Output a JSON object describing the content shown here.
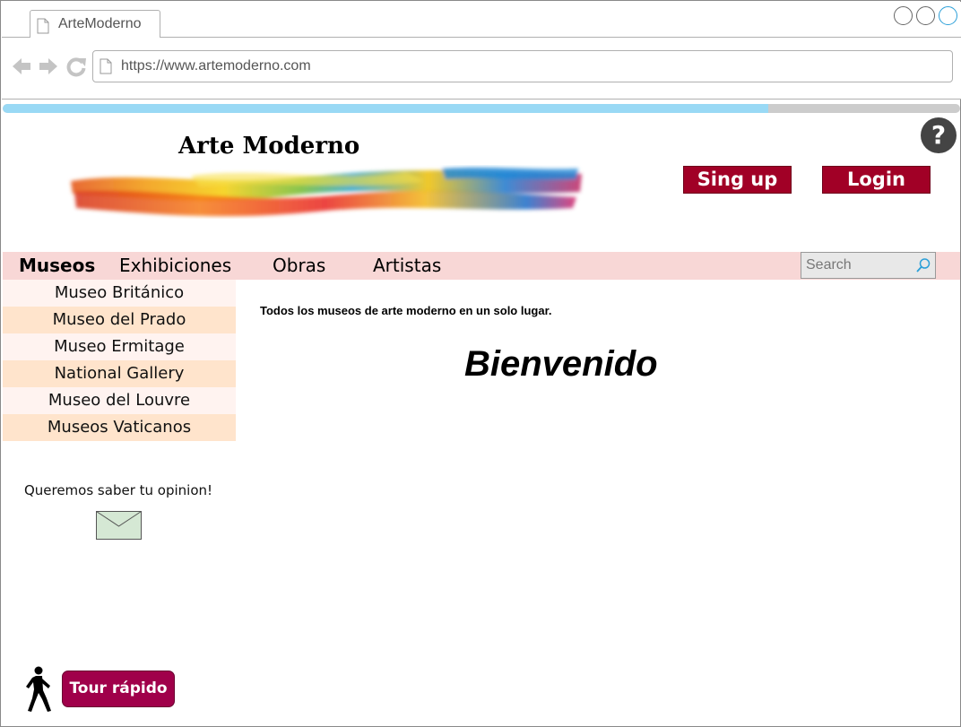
{
  "browser": {
    "tab_title": "ArteModerno",
    "url": "https://www.artemoderno.com",
    "loading_progress": 0.8
  },
  "header": {
    "site_title": "Arte Moderno",
    "signup_label": "Sing up",
    "login_label": "Login",
    "help_label": "?"
  },
  "nav": {
    "items": [
      {
        "label": "Museos",
        "active": true
      },
      {
        "label": "Exhibiciones",
        "active": false
      },
      {
        "label": "Obras",
        "active": false
      },
      {
        "label": "Artistas",
        "active": false
      }
    ],
    "search_placeholder": "Search"
  },
  "sidebar": {
    "museums": [
      "Museo Británico",
      "Museo del Prado",
      "Museo Ermitage",
      "National Gallery",
      "Museo del Louvre",
      "Museos Vaticanos"
    ],
    "feedback_text": "Queremos saber tu opinion!"
  },
  "main": {
    "tagline": "Todos los museos de arte moderno en un solo lugar.",
    "welcome": "Bienvenido"
  },
  "tour": {
    "label": "Tour rápido"
  },
  "colors": {
    "button_red": "#a10026",
    "tour_button": "#a0004a",
    "nav_background": "#f8d7d6",
    "progress_fill": "#99d9f5"
  }
}
